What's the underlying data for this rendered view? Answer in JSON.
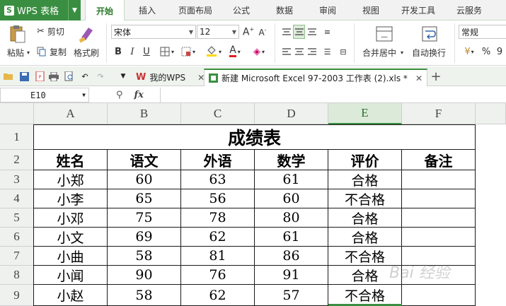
{
  "app": {
    "name": "WPS 表格",
    "logo_letter": "S"
  },
  "menu": {
    "tabs": [
      "开始",
      "插入",
      "页面布局",
      "公式",
      "数据",
      "审阅",
      "视图",
      "开发工具",
      "云服务"
    ],
    "active": 0
  },
  "ribbon": {
    "paste": "粘贴",
    "cut": "剪切",
    "copy": "复制",
    "format_painter": "格式刷",
    "font_name": "宋体",
    "font_size": "12",
    "bold": "B",
    "italic": "I",
    "underline": "U",
    "merge_center": "合并居中",
    "wrap_text": "自动换行",
    "number_format": "常规",
    "percent": "%",
    "thousands": "9",
    "font_color": "#e02020",
    "fill_color": "#ffd700"
  },
  "tabs": {
    "home_tab": "我的WPS",
    "file_tab": "新建 Microsoft Excel 97-2003 工作表 (2).xls *",
    "new_tab": "+"
  },
  "formula_bar": {
    "cell_ref": "E10",
    "fx": "fx",
    "value": ""
  },
  "sheet": {
    "columns": [
      "A",
      "B",
      "C",
      "D",
      "E",
      "F"
    ],
    "rows": [
      "1",
      "2",
      "3",
      "4",
      "5",
      "6",
      "7",
      "8",
      "9"
    ],
    "selected_column": "E",
    "title": "成绩表",
    "headers": [
      "姓名",
      "语文",
      "外语",
      "数学",
      "评价",
      "备注"
    ],
    "data": [
      [
        "小郑",
        "60",
        "63",
        "61",
        "合格",
        ""
      ],
      [
        "小李",
        "65",
        "56",
        "60",
        "不合格",
        ""
      ],
      [
        "小邓",
        "75",
        "78",
        "80",
        "合格",
        ""
      ],
      [
        "小文",
        "69",
        "62",
        "61",
        "合格",
        ""
      ],
      [
        "小曲",
        "58",
        "81",
        "86",
        "不合格",
        ""
      ],
      [
        "小闻",
        "90",
        "76",
        "91",
        "合格",
        ""
      ],
      [
        "小赵",
        "58",
        "62",
        "57",
        "不合格",
        ""
      ]
    ]
  },
  "watermark": "Bai 经验"
}
